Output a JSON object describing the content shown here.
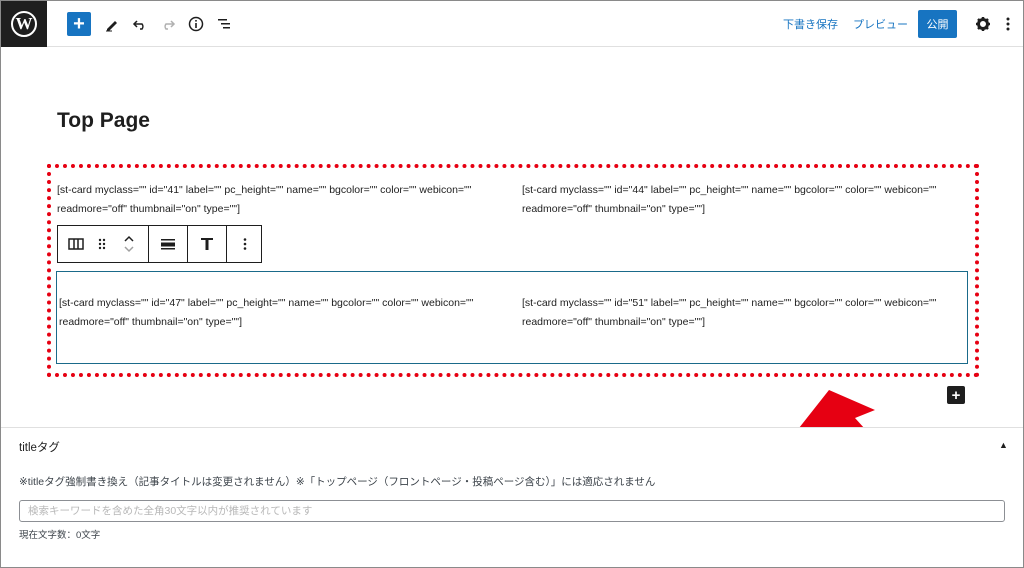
{
  "toolbar": {
    "logo_letter": "W",
    "add_icon": "+",
    "tool_icon": "pencil-icon",
    "undo_icon": "undo-icon",
    "redo_icon": "redo-icon",
    "info_icon": "info-icon",
    "list_icon": "list-view-icon",
    "save_draft_label": "下書き保存",
    "preview_label": "プレビュー",
    "publish_label": "公開",
    "accent_color": "#1774c1"
  },
  "editor": {
    "post_title": "Top Page",
    "shortcodes": [
      "[st-card myclass=\"\" id=\"41\" label=\"\" pc_height=\"\" name=\"\" bgcolor=\"\" color=\"\" webicon=\"\" readmore=\"off\" thumbnail=\"on\" type=\"\"]",
      "[st-card myclass=\"\" id=\"44\" label=\"\" pc_height=\"\" name=\"\" bgcolor=\"\" color=\"\" webicon=\"\" readmore=\"off\" thumbnail=\"on\" type=\"\"]",
      "[st-card myclass=\"\" id=\"47\" label=\"\" pc_height=\"\" name=\"\" bgcolor=\"\" color=\"\" webicon=\"\" readmore=\"off\" thumbnail=\"on\" type=\"\"]",
      "[st-card myclass=\"\" id=\"51\" label=\"\" pc_height=\"\" name=\"\" bgcolor=\"\" color=\"\" webicon=\"\" readmore=\"off\" thumbnail=\"on\" type=\"\"]"
    ],
    "highlight_color": "#e60012"
  },
  "meta_box": {
    "title": "titleタグ",
    "note": "※titleタグ強制書き換え（記事タイトルは変更されません）※「トップページ（フロントページ・投稿ページ含む）」には適応されません",
    "input_placeholder": "検索キーワードを含めた全角30文字以内が推奨されています",
    "input_value": "",
    "char_count": "現在文字数：0文字"
  }
}
